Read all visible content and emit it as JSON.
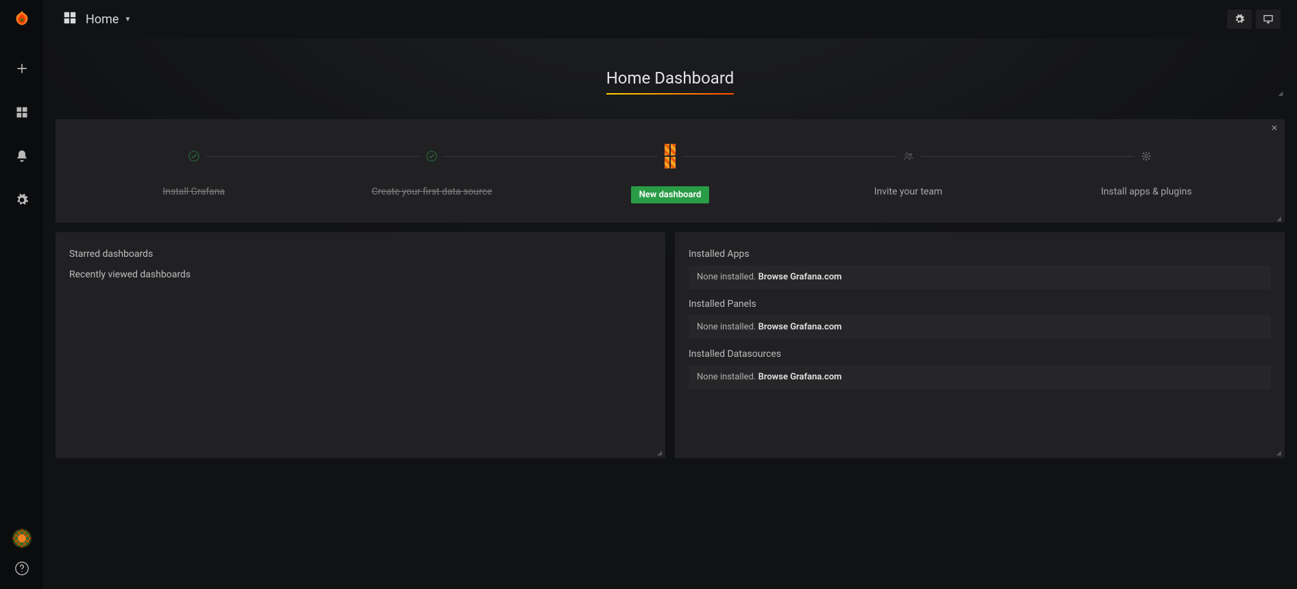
{
  "sidebar": {
    "nav": [
      "create",
      "dashboards",
      "alerting",
      "configuration"
    ],
    "avatar_tip": "admin",
    "help_tip": "Help"
  },
  "topbar": {
    "home_label": "Home",
    "gear_tip": "Dashboard settings",
    "cycle_tip": "Cycle view mode"
  },
  "title": "Home Dashboard",
  "steps": [
    {
      "label": "Install Grafana",
      "state": "done"
    },
    {
      "label": "Create your first data source",
      "state": "done"
    },
    {
      "label": "New dashboard",
      "state": "cta",
      "button": "New dashboard"
    },
    {
      "label": "Invite your team",
      "state": "todo"
    },
    {
      "label": "Install apps & plugins",
      "state": "todo"
    }
  ],
  "left_panel": {
    "starred_title": "Starred dashboards",
    "recent_title": "Recently viewed dashboards"
  },
  "right_panel": {
    "apps": {
      "title": "Installed Apps",
      "none": "None installed.",
      "link": "Browse Grafana.com"
    },
    "panels": {
      "title": "Installed Panels",
      "none": "None installed.",
      "link": "Browse Grafana.com"
    },
    "datasources": {
      "title": "Installed Datasources",
      "none": "None installed.",
      "link": "Browse Grafana.com"
    }
  }
}
